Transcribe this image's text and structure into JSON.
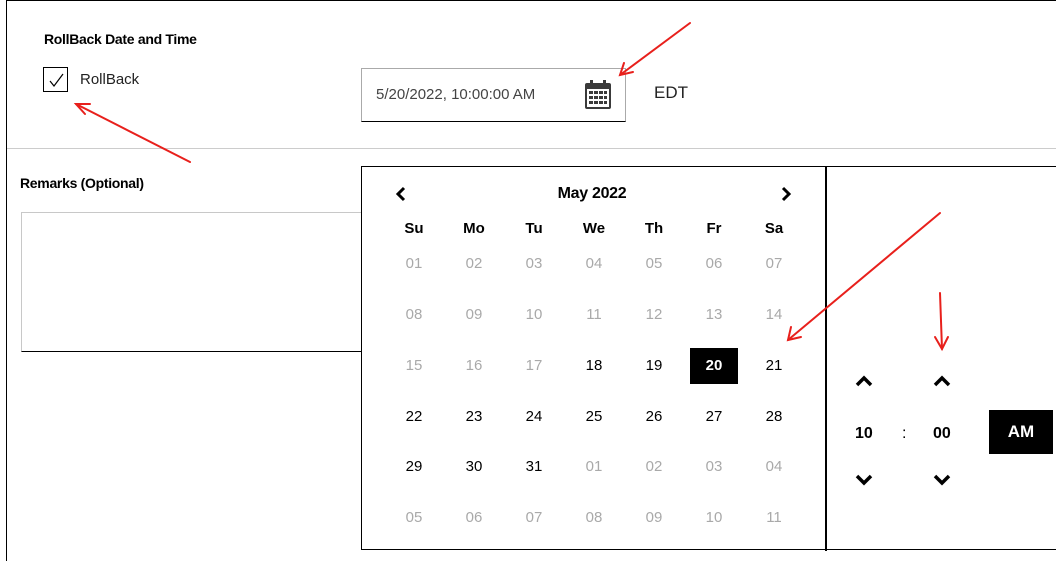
{
  "section": {
    "title": "RollBack Date and Time"
  },
  "rollback": {
    "label": "RollBack",
    "checked": true
  },
  "datetime": {
    "value": "5/20/2022, 10:00:00 AM",
    "timezone": "EDT",
    "icon": "calendar-icon"
  },
  "remarks": {
    "label": "Remarks (Optional)",
    "value": ""
  },
  "calendar": {
    "month_label": "May 2022",
    "weekdays": [
      "Su",
      "Mo",
      "Tu",
      "We",
      "Th",
      "Fr",
      "Sa"
    ],
    "weeks": [
      [
        {
          "d": "01",
          "m": true
        },
        {
          "d": "02",
          "m": true
        },
        {
          "d": "03",
          "m": true
        },
        {
          "d": "04",
          "m": true
        },
        {
          "d": "05",
          "m": true
        },
        {
          "d": "06",
          "m": true
        },
        {
          "d": "07",
          "m": true
        }
      ],
      [
        {
          "d": "08",
          "m": true
        },
        {
          "d": "09",
          "m": true
        },
        {
          "d": "10",
          "m": true
        },
        {
          "d": "11",
          "m": true
        },
        {
          "d": "12",
          "m": true
        },
        {
          "d": "13",
          "m": true
        },
        {
          "d": "14",
          "m": true
        }
      ],
      [
        {
          "d": "15",
          "m": true
        },
        {
          "d": "16",
          "m": true
        },
        {
          "d": "17",
          "m": true
        },
        {
          "d": "18",
          "m": false
        },
        {
          "d": "19",
          "m": false
        },
        {
          "d": "20",
          "m": false,
          "s": true
        },
        {
          "d": "21",
          "m": false
        }
      ],
      [
        {
          "d": "22",
          "m": false
        },
        {
          "d": "23",
          "m": false
        },
        {
          "d": "24",
          "m": false
        },
        {
          "d": "25",
          "m": false
        },
        {
          "d": "26",
          "m": false
        },
        {
          "d": "27",
          "m": false
        },
        {
          "d": "28",
          "m": false
        }
      ],
      [
        {
          "d": "29",
          "m": false
        },
        {
          "d": "30",
          "m": false
        },
        {
          "d": "31",
          "m": false
        },
        {
          "d": "01",
          "m": true
        },
        {
          "d": "02",
          "m": true
        },
        {
          "d": "03",
          "m": true
        },
        {
          "d": "04",
          "m": true
        }
      ],
      [
        {
          "d": "05",
          "m": true
        },
        {
          "d": "06",
          "m": true
        },
        {
          "d": "07",
          "m": true
        },
        {
          "d": "08",
          "m": true
        },
        {
          "d": "09",
          "m": true
        },
        {
          "d": "10",
          "m": true
        },
        {
          "d": "11",
          "m": true
        }
      ]
    ]
  },
  "time": {
    "hour": "10",
    "separator": ":",
    "minute": "00",
    "ampm": "AM"
  },
  "colors": {
    "annotation": "#e8201c",
    "selected_bg": "#000000",
    "muted_text": "#a9a9a9"
  }
}
